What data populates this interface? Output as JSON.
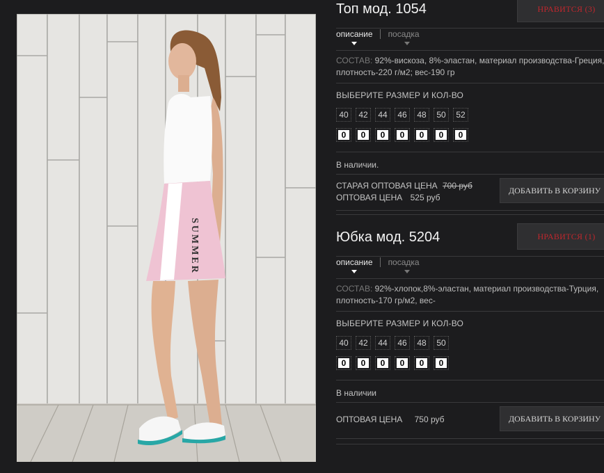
{
  "photo": {
    "skirt_print": "SUMMER"
  },
  "products": [
    {
      "title": "Топ мод. 1054",
      "like_label": "НРАВИТСЯ (3)",
      "tabs": {
        "description": "описание",
        "fit": "посадка"
      },
      "composition_label": "СОСТАВ:",
      "composition_line1": "92%-вискоза, 8%-эластан, материал производства-Греция,",
      "composition_line2": "плотность-220 г/м2; вес-190 гр",
      "size_heading": "ВЫБЕРИТЕ РАЗМЕР И КОЛ-ВО",
      "sizes": [
        "40",
        "42",
        "44",
        "46",
        "48",
        "50",
        "52"
      ],
      "quantities": [
        "0",
        "0",
        "0",
        "0",
        "0",
        "0",
        "0"
      ],
      "stock": "В наличии.",
      "old_price_label": "СТАРАЯ ОПТОВАЯ ЦЕНА",
      "old_price": "700 руб",
      "price_label": "ОПТОВАЯ ЦЕНА",
      "price": "525 руб",
      "cart_label": "ДОБАВИТЬ В КОРЗИНУ"
    },
    {
      "title": "Юбка мод. 5204",
      "like_label": "НРАВИТСЯ (1)",
      "tabs": {
        "description": "описание",
        "fit": "посадка"
      },
      "composition_label": "СОСТАВ:",
      "composition_line1": "92%-хлопок,8%-эластан, материал производства-Турция,",
      "composition_line2": "плотность-170 гр/м2, вес-",
      "size_heading": "ВЫБЕРИТЕ РАЗМЕР И КОЛ-ВО",
      "sizes": [
        "40",
        "42",
        "44",
        "46",
        "48",
        "50"
      ],
      "quantities": [
        "0",
        "0",
        "0",
        "0",
        "0",
        "0"
      ],
      "stock": "В наличии",
      "price_label": "ОПТОВАЯ ЦЕНА",
      "price": "750 руб",
      "cart_label": "ДОБАВИТЬ В КОРЗИНУ"
    }
  ],
  "colors": {
    "background": "#1c1c1e",
    "like_text": "#c0272d",
    "button_bg": "#2f2f31",
    "skirt": "#efc3d3"
  }
}
